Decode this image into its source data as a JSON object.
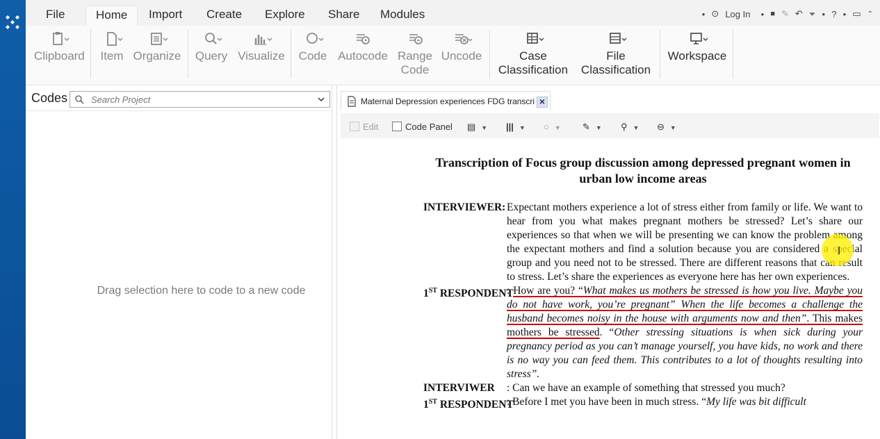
{
  "menu": {
    "tabs": [
      "File",
      "Home",
      "Import",
      "Create",
      "Explore",
      "Share",
      "Modules"
    ],
    "active": "Home",
    "login_label": "Log In"
  },
  "ribbon": {
    "clipboard": "Clipboard",
    "item": "Item",
    "organize": "Organize",
    "query": "Query",
    "visualize": "Visualize",
    "code": "Code",
    "autocode": "Autocode",
    "range_code_1": "Range",
    "range_code_2": "Code",
    "uncode": "Uncode",
    "case_1": "Case",
    "case_2": "Classification",
    "file_1": "File",
    "file_2": "Classification",
    "workspace": "Workspace"
  },
  "codes_panel": {
    "title": "Codes",
    "search_placeholder": "Search Project",
    "drag_hint": "Drag selection here to code to a new code"
  },
  "document": {
    "tab_title": "Maternal Depression experiences FDG transcri",
    "toolbar": {
      "edit": "Edit",
      "code_panel": "Code Panel"
    }
  },
  "transcript": {
    "title": "Transcription of Focus group discussion among depressed pregnant women in urban low income areas",
    "t1_speaker": "INTERVIEWER:",
    "t1_text": "Expectant mothers experience a lot of stress either from family or life. We want to hear from you what makes pregnant mothers be stressed? Let’s share our experiences so that when we will be presenting we can know the problem among the expectant mothers and find a solution because you are considered a special group and you need not to be stressed. There are different reasons that can result to stress. Let’s share the experiences as everyone here has her own experiences.",
    "t2_speaker_num": "1",
    "t2_speaker_sup": "ST",
    "t2_speaker_word": "RESPONDENT",
    "t2_a": ": ",
    "t2_b": "How are you? “",
    "t2_c": "What makes us mothers be stressed is how you live. Maybe you do not have work, you’re pregnant” When the life becomes a challenge the husband becomes noisy in the house with arguments now and then”",
    "t2_d": ". This makes mothers be stressed",
    "t2_e": ". “",
    "t2_f": "Other stressing situations is when sick during your pregnancy period as you can’t manage yourself, you have kids, no work and there is no way you can feed them. This contributes to a lot of thoughts resulting into stress”.",
    "t3_speaker": "INTERVIWER",
    "t3_text": ": Can we have an example of something that stressed you much?",
    "t4_speaker_num": "1",
    "t4_speaker_sup": "ST",
    "t4_speaker_word": "RESPONDENT",
    "t4_a": ": Before I met you have been in much stress. “",
    "t4_b": "My life was bit difficult"
  }
}
